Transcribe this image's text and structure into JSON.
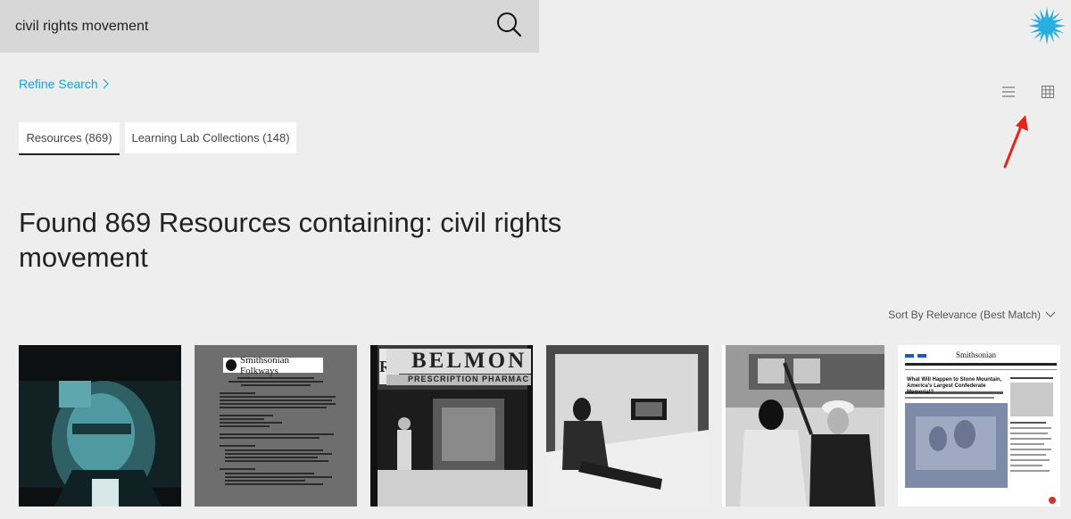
{
  "search": {
    "value": "civil rights movement",
    "placeholder": ""
  },
  "refine_label": "Refine Search",
  "tabs": [
    {
      "label": "Resources (869)",
      "active": true
    },
    {
      "label": "Learning Lab Collections (148)",
      "active": false
    }
  ],
  "results_heading": "Found 869 Resources containing: civil rights movement",
  "sort_label": "Sort By Relevance (Best Match)",
  "thumbnails": {
    "folkways_logo": "Smithsonian Folkways",
    "belmont_sign": "BELMON",
    "belmont_sub": "PRESCRIPTION PHARMAC",
    "rx_sign": "Rx",
    "magazine_logo": "Smithsonian",
    "magazine_headline": "What Will Happen to Stone Mountain, America's Largest Confederate Memorial?"
  },
  "icons": {
    "search": "search-icon",
    "logo": "sunburst-logo-icon",
    "list_view": "list-view-icon",
    "grid_view": "grid-view-icon",
    "chevron": "chevron-right-icon",
    "sort_chevron": "chevron-down-icon"
  },
  "colors": {
    "accent": "#1aa3d4",
    "logo": "#29aee0",
    "annotation_arrow": "#e8231a"
  }
}
